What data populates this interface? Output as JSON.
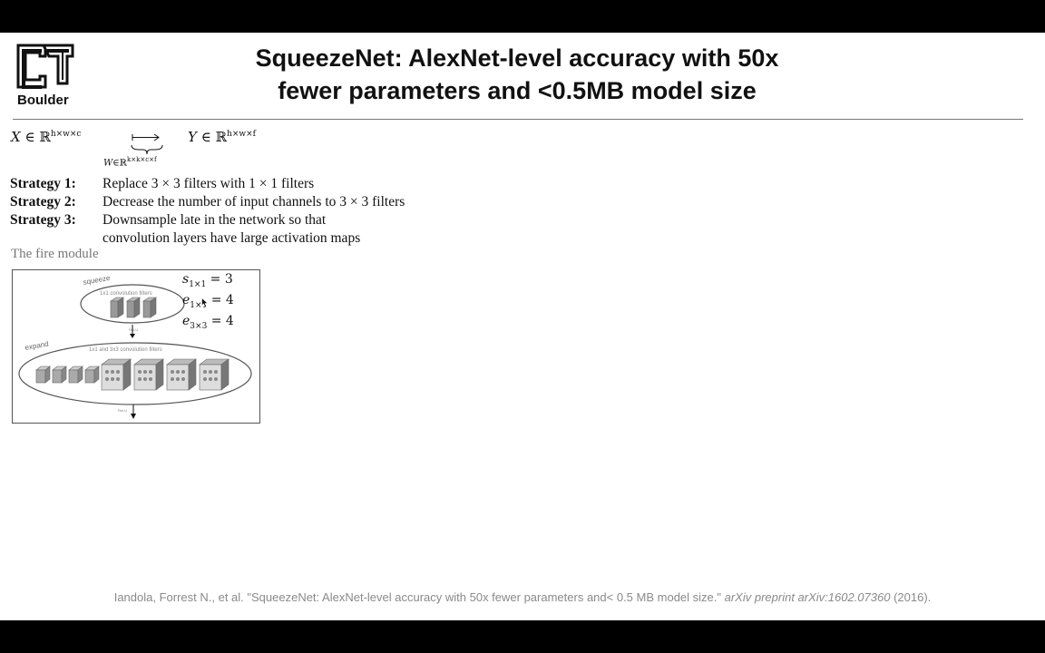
{
  "logo": {
    "name": "cu-boulder-logo",
    "text": "Boulder"
  },
  "title": {
    "line1": "SqueezeNet: AlexNet-level accuracy with 50x",
    "line2": "fewer parameters and <0.5MB model size"
  },
  "formula": {
    "x": {
      "var": "X",
      "rel": "∈ ℝ",
      "sup": "h×w×c"
    },
    "y": {
      "var": "Y",
      "rel": "∈ ℝ",
      "sup": "h×w×f"
    },
    "w": {
      "var": "W",
      "rel": "∈ℝ",
      "sup": "k×k×c×f"
    }
  },
  "strategies": [
    {
      "label": "Strategy 1:",
      "text": "Replace 3 × 3 filters with 1 × 1 filters"
    },
    {
      "label": "Strategy 2:",
      "text": "Decrease the number of input channels to 3 × 3 filters"
    },
    {
      "label": "Strategy 3:",
      "text": "Downsample late in the network so that convolution layers have large activation maps"
    }
  ],
  "fire_module": {
    "label": "The fire module",
    "squeeze_label": "squeeze",
    "squeeze_caption": "1x1 convolution filters",
    "expand_label": "expand",
    "expand_caption": "1x1 and 3x3 convolution filters",
    "relu_label": "ReLU",
    "hyperparams": [
      {
        "var": "s",
        "sub": "1×1",
        "value": "= 3"
      },
      {
        "var": "e",
        "sub": "1×1",
        "value": "= 4"
      },
      {
        "var": "e",
        "sub": "3×3",
        "value": "= 4"
      }
    ]
  },
  "citation": {
    "text": "Iandola, Forrest N., et al. \"SqueezeNet: AlexNet-level accuracy with 50x fewer parameters and< 0.5 MB model size.\"",
    "journal": "arXiv preprint arXiv:1602.07360",
    "year": "(2016)."
  }
}
